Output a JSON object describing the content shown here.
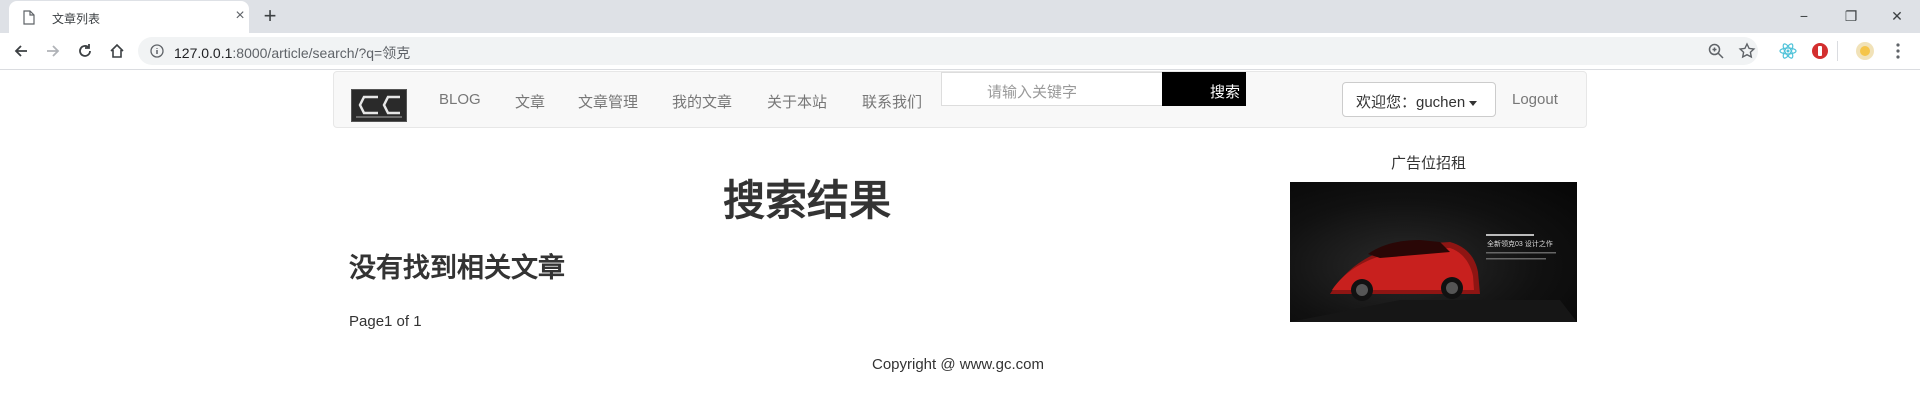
{
  "browser": {
    "tab_title": "文章列表",
    "tab_close": "×",
    "new_tab": "+",
    "url_host": "127.0.0.1",
    "url_rest": ":8000/article/search/?q=领克",
    "window_minimize": "−",
    "window_restore": "❐",
    "window_close": "✕"
  },
  "navbar": {
    "links": [
      "BLOG",
      "文章",
      "文章管理",
      "我的文章",
      "关于本站",
      "联系我们"
    ],
    "search_placeholder": "请输入关键字",
    "search_button": "搜索",
    "user_dropdown": "欢迎您：guchen",
    "logout": "Logout"
  },
  "main": {
    "title": "搜索结果",
    "no_result": "没有找到相关文章",
    "pager": "Page1 of 1"
  },
  "sidebar": {
    "ad_title": "广告位招租",
    "ad_caption": "全新领克03 设计之作"
  },
  "footer": {
    "copyright": "Copyright @ www.gc.com"
  },
  "colors": {
    "navbar_bg": "#f8f8f8",
    "search_button_bg": "#000000",
    "link_color": "#777777",
    "car_red": "#c8201e"
  }
}
